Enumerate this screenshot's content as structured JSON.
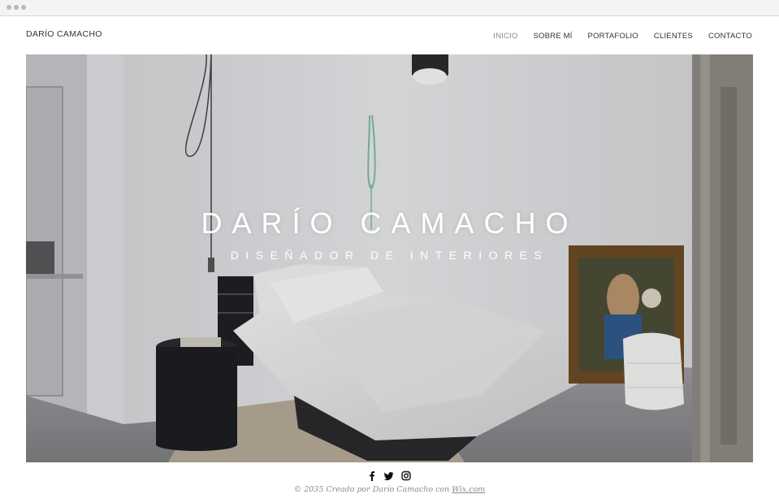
{
  "site": {
    "title": "DARÍO CAMACHO"
  },
  "nav": {
    "items": [
      {
        "label": "INICIO",
        "active": true
      },
      {
        "label": "SOBRE MÍ",
        "active": false
      },
      {
        "label": "PORTAFOLIO",
        "active": false
      },
      {
        "label": "CLIENTES",
        "active": false
      },
      {
        "label": "CONTACTO",
        "active": false
      }
    ]
  },
  "hero": {
    "title": "DARÍO CAMACHO",
    "subtitle": "DISEÑADOR DE INTERIORES"
  },
  "social": {
    "icons": [
      "facebook-icon",
      "twitter-icon",
      "instagram-icon"
    ]
  },
  "footer": {
    "text": "© 2035 Creado por Darío Camacho con ",
    "link": "Wix.com"
  },
  "colors": {
    "text": "#333333",
    "active_nav": "#8a8a8a",
    "footer_text": "#8a8a8a"
  }
}
